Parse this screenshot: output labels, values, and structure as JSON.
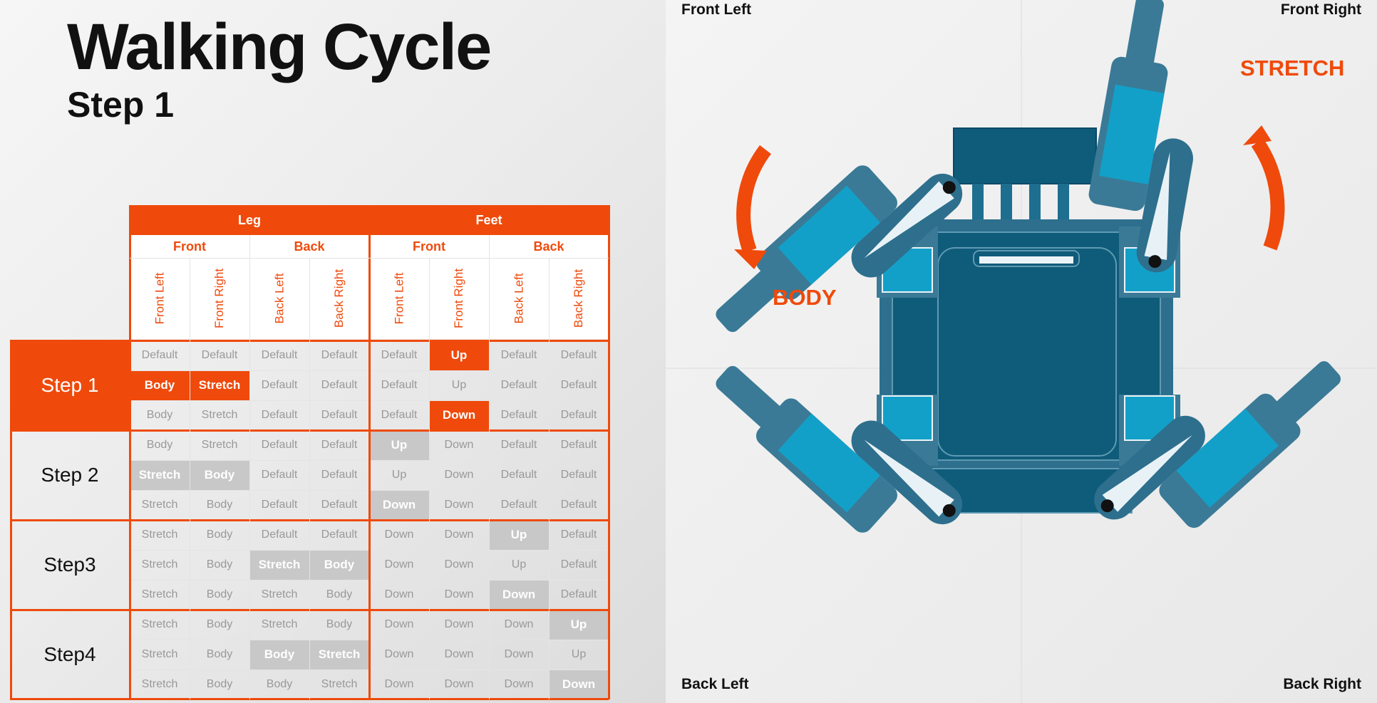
{
  "title": "Walking Cycle",
  "subtitle": "Step 1",
  "colors": {
    "accent": "#ef4a0b",
    "highlight_gray": "#c8c8c8",
    "robot_dark": "#0f5b7a",
    "robot_mid": "#3a7a96",
    "robot_light": "#13a0c8"
  },
  "table": {
    "group_headers": [
      "Leg",
      "Feet"
    ],
    "sub_headers": [
      "Front",
      "Back",
      "Front",
      "Back"
    ],
    "column_headers": [
      "Front Left",
      "Front Right",
      "Back Left",
      "Back Right",
      "Front Left",
      "Front Right",
      "Back Left",
      "Back Right"
    ],
    "steps": [
      {
        "label": "Step 1",
        "active": true,
        "rows": [
          {
            "cells": [
              "Default",
              "Default",
              "Default",
              "Default",
              "Default",
              "Up",
              "Default",
              "Default"
            ],
            "highlight": [
              "",
              "",
              "",
              "",
              "",
              "orange",
              "",
              ""
            ]
          },
          {
            "cells": [
              "Body",
              "Stretch",
              "Default",
              "Default",
              "Default",
              "Up",
              "Default",
              "Default"
            ],
            "highlight": [
              "orange",
              "orange",
              "",
              "",
              "",
              "",
              "",
              ""
            ]
          },
          {
            "cells": [
              "Body",
              "Stretch",
              "Default",
              "Default",
              "Default",
              "Down",
              "Default",
              "Default"
            ],
            "highlight": [
              "",
              "",
              "",
              "",
              "",
              "orange",
              "",
              ""
            ]
          }
        ]
      },
      {
        "label": "Step 2",
        "active": false,
        "rows": [
          {
            "cells": [
              "Body",
              "Stretch",
              "Default",
              "Default",
              "Up",
              "Down",
              "Default",
              "Default"
            ],
            "highlight": [
              "",
              "",
              "",
              "",
              "gray",
              "",
              "",
              ""
            ]
          },
          {
            "cells": [
              "Stretch",
              "Body",
              "Default",
              "Default",
              "Up",
              "Down",
              "Default",
              "Default"
            ],
            "highlight": [
              "gray",
              "gray",
              "",
              "",
              "",
              "",
              "",
              ""
            ]
          },
          {
            "cells": [
              "Stretch",
              "Body",
              "Default",
              "Default",
              "Down",
              "Down",
              "Default",
              "Default"
            ],
            "highlight": [
              "",
              "",
              "",
              "",
              "gray",
              "",
              "",
              ""
            ]
          }
        ]
      },
      {
        "label": "Step3",
        "active": false,
        "rows": [
          {
            "cells": [
              "Stretch",
              "Body",
              "Default",
              "Default",
              "Down",
              "Down",
              "Up",
              "Default"
            ],
            "highlight": [
              "",
              "",
              "",
              "",
              "",
              "",
              "gray",
              ""
            ]
          },
          {
            "cells": [
              "Stretch",
              "Body",
              "Stretch",
              "Body",
              "Down",
              "Down",
              "Up",
              "Default"
            ],
            "highlight": [
              "",
              "",
              "gray",
              "gray",
              "",
              "",
              "",
              ""
            ]
          },
          {
            "cells": [
              "Stretch",
              "Body",
              "Stretch",
              "Body",
              "Down",
              "Down",
              "Down",
              "Default"
            ],
            "highlight": [
              "",
              "",
              "",
              "",
              "",
              "",
              "gray",
              ""
            ]
          }
        ]
      },
      {
        "label": "Step4",
        "active": false,
        "rows": [
          {
            "cells": [
              "Stretch",
              "Body",
              "Stretch",
              "Body",
              "Down",
              "Down",
              "Down",
              "Up"
            ],
            "highlight": [
              "",
              "",
              "",
              "",
              "",
              "",
              "",
              "gray"
            ]
          },
          {
            "cells": [
              "Stretch",
              "Body",
              "Body",
              "Stretch",
              "Down",
              "Down",
              "Down",
              "Up"
            ],
            "highlight": [
              "",
              "",
              "gray",
              "gray",
              "",
              "",
              "",
              ""
            ]
          },
          {
            "cells": [
              "Stretch",
              "Body",
              "Body",
              "Stretch",
              "Down",
              "Down",
              "Down",
              "Down"
            ],
            "highlight": [
              "",
              "",
              "",
              "",
              "",
              "",
              "",
              "gray"
            ]
          }
        ]
      }
    ]
  },
  "diagram": {
    "corner_labels": {
      "front_left": "Front Left",
      "front_right": "Front Right",
      "back_left": "Back Left",
      "back_right": "Back Right"
    },
    "action_left": "BODY",
    "action_right": "STRETCH"
  }
}
